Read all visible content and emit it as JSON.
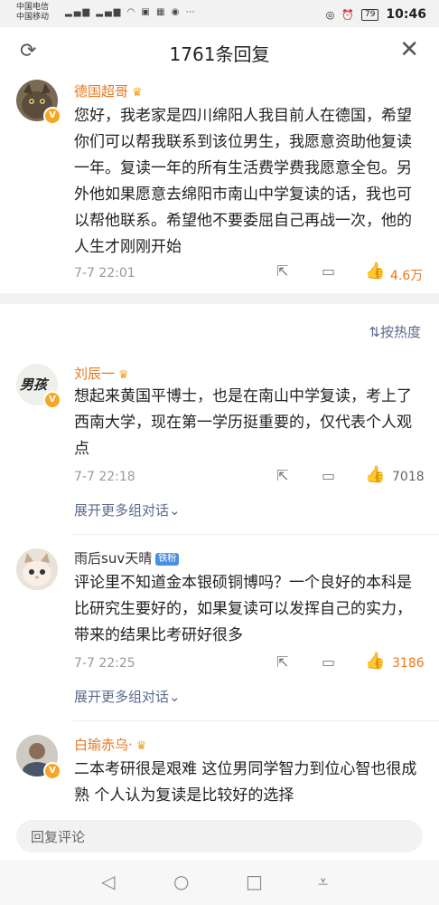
{
  "status": {
    "carrier1": "中国电信",
    "carrier2": "中国移动",
    "battery": "79",
    "time": "10:46"
  },
  "header": {
    "title": "1761条回复"
  },
  "top_comment": {
    "user": "德国超哥",
    "text": "您好，我老家是四川绵阳人我目前人在德国，希望你们可以帮我联系到该位男生，我愿意资助他复读一年。复读一年的所有生活费学费我愿意全包。另外他如果愿意去绵阳市南山中学复读的话，我也可以帮他联系。希望他不要委屈自己再战一次，他的人生才刚刚开始",
    "date": "7-7 22:01",
    "likes": "4.6万"
  },
  "sort_label": "按热度",
  "comments": [
    {
      "user": "刘辰一",
      "avatar_text": "男孩",
      "text": "想起来黄国平博士，也是在南山中学复读，考上了西南大学，现在第一学历挺重要的，仅代表个人观点",
      "date": "7-7 22:18",
      "likes": "7018",
      "expand": "展开更多组对话"
    },
    {
      "user": "雨后suv天晴",
      "tag": "铁粉",
      "text": "评论里不知道金本银硕铜博吗？一个良好的本科是比研究生要好的，如果复读可以发挥自己的实力，带来的结果比考研好很多",
      "date": "7-7 22:25",
      "likes": "3186",
      "expand": "展开更多组对话"
    },
    {
      "user": "白瑜赤乌·",
      "text": "二本考研很是艰难  这位男同学智力到位心智也很成熟  个人认为复读是比较好的选择"
    }
  ],
  "reply_placeholder": "回复评论",
  "colors": {
    "accent": "#e8771d",
    "link": "#5a6b8c",
    "badge": "#f5a623"
  }
}
